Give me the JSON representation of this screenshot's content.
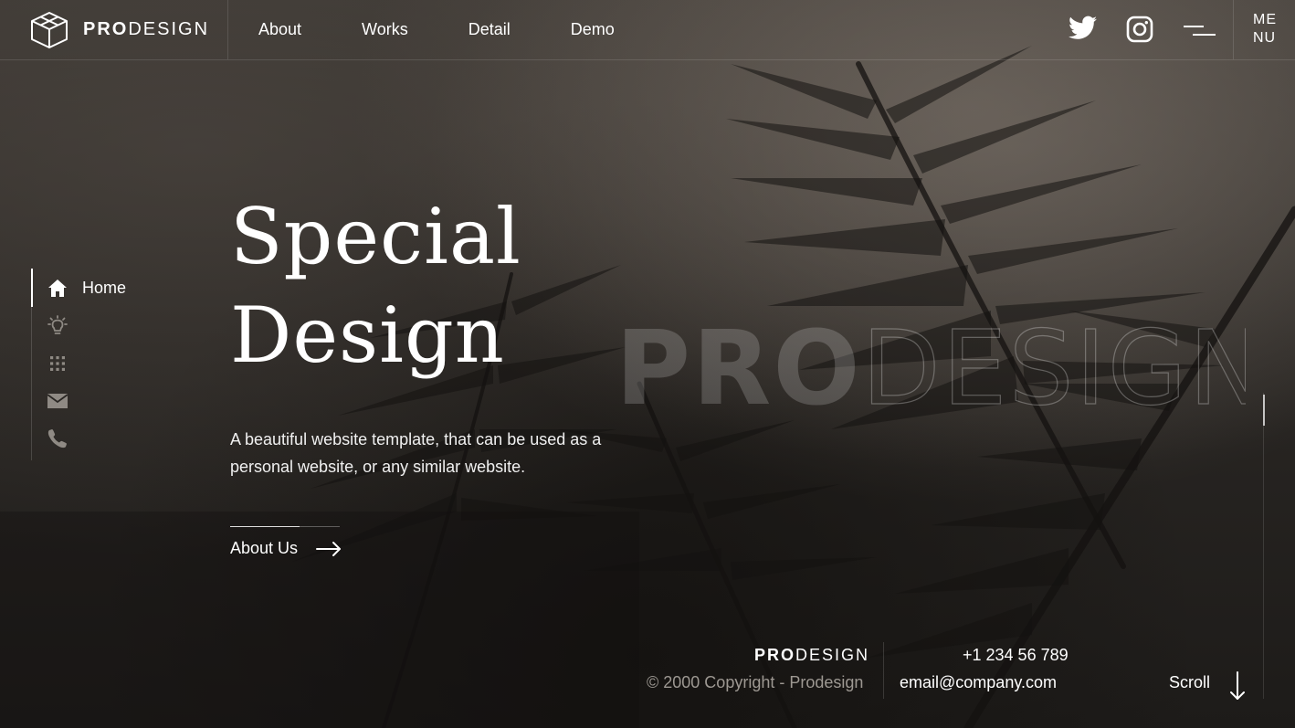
{
  "brand": {
    "bold": "PRO",
    "light": "DESIGN"
  },
  "nav": {
    "items": [
      "About",
      "Works",
      "Detail",
      "Demo"
    ]
  },
  "menu": {
    "line1": "ME",
    "line2": "NU"
  },
  "sidenav": {
    "items": [
      {
        "label": "Home",
        "icon": "home-icon",
        "active": true
      },
      {
        "icon": "lightbulb-icon"
      },
      {
        "icon": "grid-icon"
      },
      {
        "icon": "mail-icon"
      },
      {
        "icon": "phone-icon"
      }
    ]
  },
  "hero": {
    "title_line1": "Special",
    "title_line2": "Design",
    "subtitle": "A beautiful website template, that can be used as a personal website, or any similar website.",
    "cta_label": "About Us"
  },
  "watermark": {
    "bold": "PRO",
    "outline": "DESIGN"
  },
  "footer": {
    "brand_bold": "PRO",
    "brand_light": "DESIGN",
    "copyright": "© 2000 Copyright - Prodesign",
    "phone": "+1 234 56 789",
    "email": "email@company.com",
    "scroll_label": "Scroll"
  },
  "colors": {
    "text": "#ffffff",
    "muted": "#9d9892",
    "background": "#2a2724"
  }
}
